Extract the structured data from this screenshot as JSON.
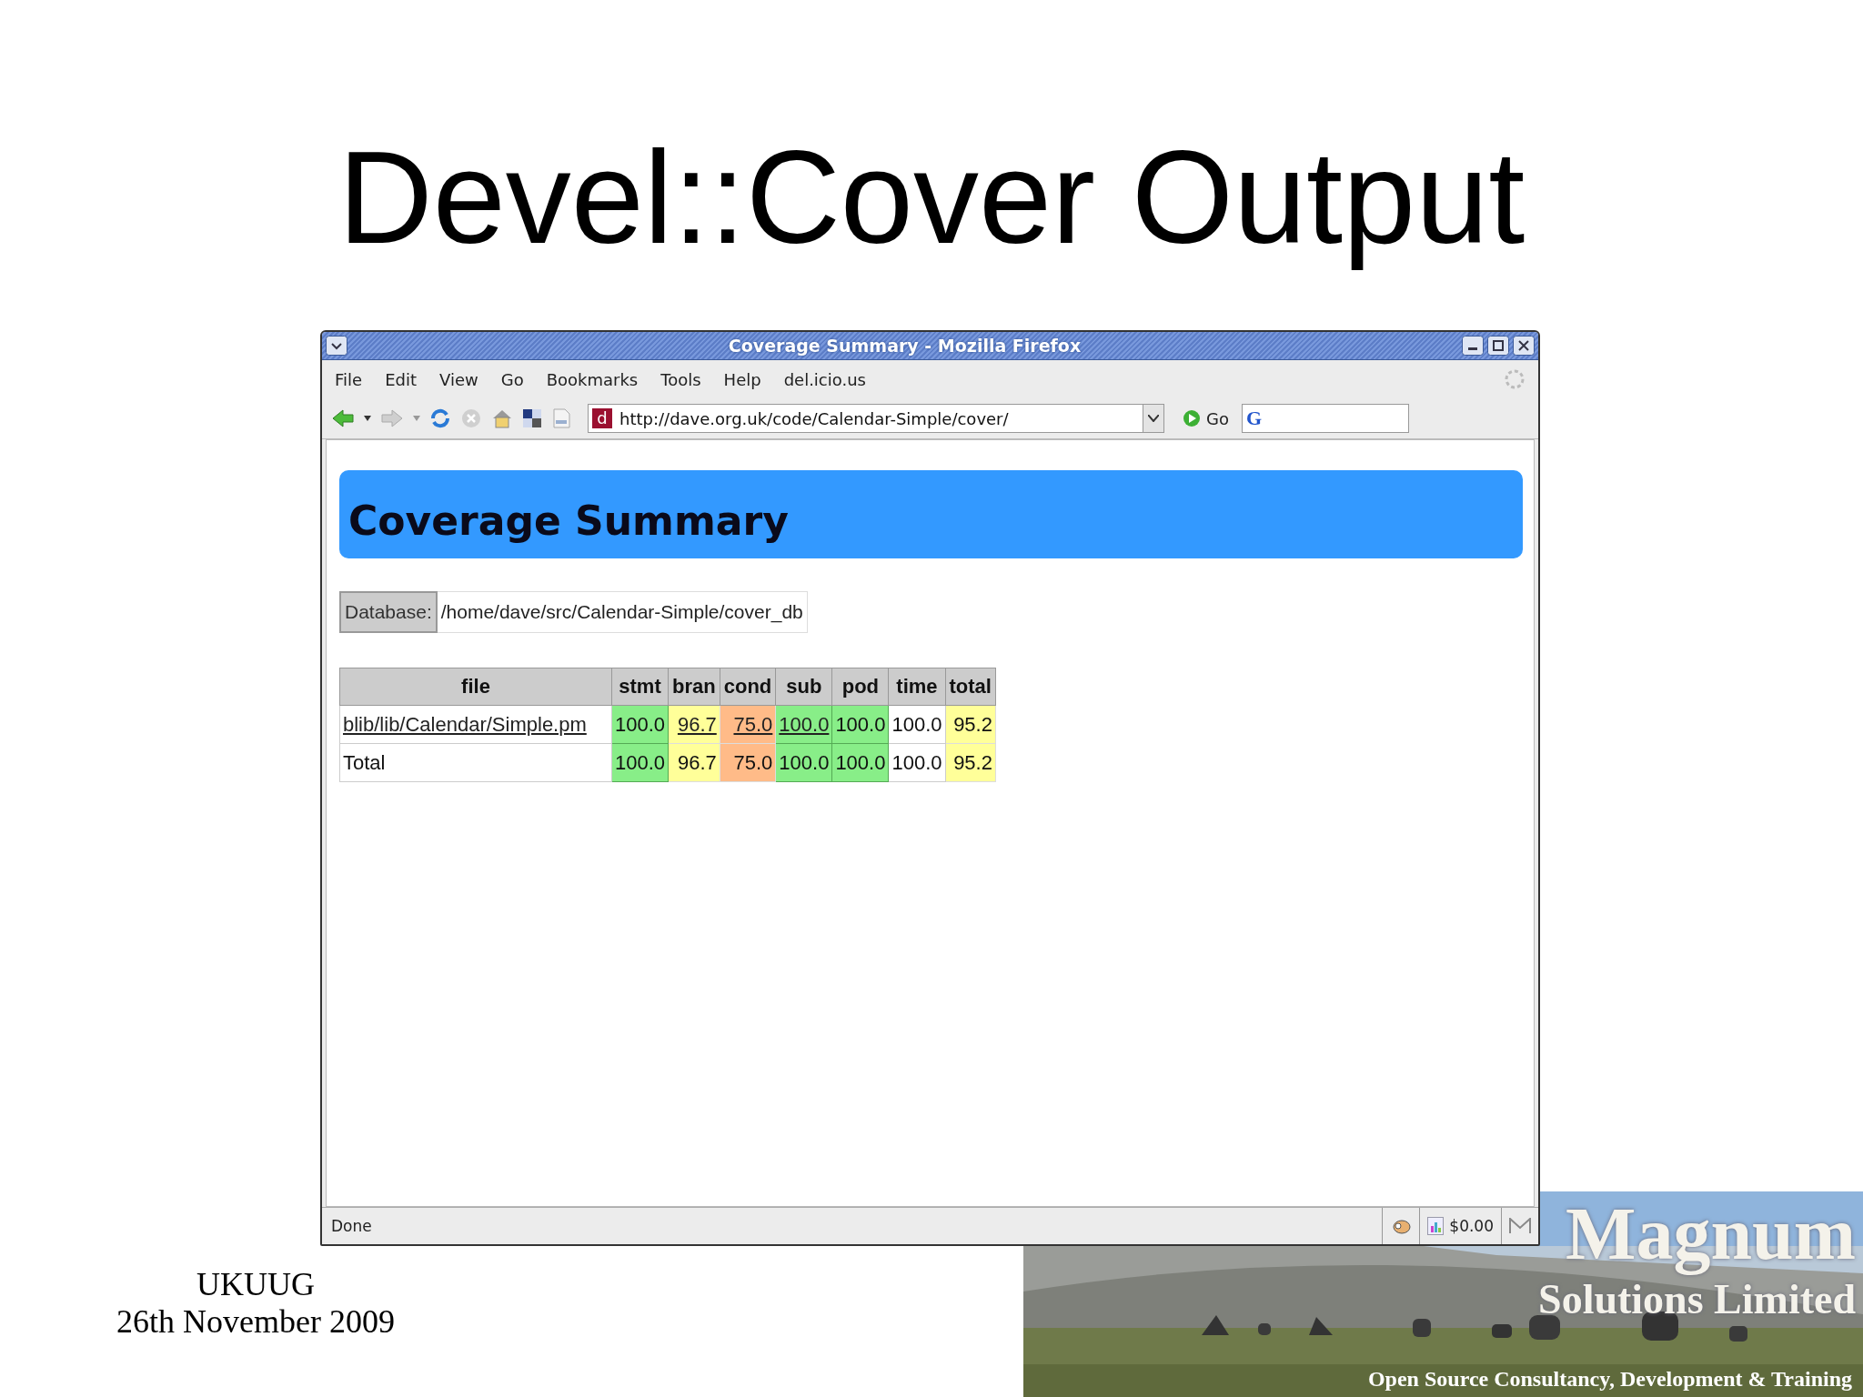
{
  "slide": {
    "title": "Devel::Cover Output",
    "footer": [
      "UKUUG",
      "26th November 2009"
    ]
  },
  "browser": {
    "title": "Coverage Summary - Mozilla Firefox",
    "menu": [
      "File",
      "Edit",
      "View",
      "Go",
      "Bookmarks",
      "Tools",
      "Help",
      "del.icio.us"
    ],
    "favicon": "d",
    "url": "http://dave.org.uk/code/Calendar-Simple/cover/",
    "go": "Go",
    "search_logo": "G",
    "status": "Done",
    "status_amount": "$0.00"
  },
  "page": {
    "heading": "Coverage Summary",
    "database_label": "Database:",
    "database_path": "/home/dave/src/Calendar-Simple/cover_db",
    "table": {
      "columns": [
        "file",
        "stmt",
        "bran",
        "cond",
        "sub",
        "pod",
        "time",
        "total"
      ],
      "rows": [
        {
          "cells": [
            {
              "text": "blib/lib/Calendar/Simple.pm",
              "link": true
            },
            {
              "text": "100.0",
              "link": false,
              "color": "#88ee88"
            },
            {
              "text": "96.7",
              "link": true,
              "color": "#ffff99"
            },
            {
              "text": "75.0",
              "link": true,
              "color": "#ffbb88"
            },
            {
              "text": "100.0",
              "link": true,
              "color": "#88ee88"
            },
            {
              "text": "100.0",
              "link": false,
              "color": "#88ee88"
            },
            {
              "text": "100.0",
              "link": false
            },
            {
              "text": "95.2",
              "link": false,
              "color": "#ffff99"
            }
          ]
        },
        {
          "cells": [
            {
              "text": "Total",
              "link": false
            },
            {
              "text": "100.0",
              "link": false,
              "color": "#88ee88"
            },
            {
              "text": "96.7",
              "link": false,
              "color": "#ffff99"
            },
            {
              "text": "75.0",
              "link": false,
              "color": "#ffbb88"
            },
            {
              "text": "100.0",
              "link": false,
              "color": "#88ee88"
            },
            {
              "text": "100.0",
              "link": false,
              "color": "#88ee88"
            },
            {
              "text": "100.0",
              "link": false
            },
            {
              "text": "95.2",
              "link": false,
              "color": "#ffff99"
            }
          ]
        }
      ]
    }
  },
  "banner": {
    "kind": "picture",
    "logo": [
      "Magnum",
      "Solutions Limited"
    ],
    "tagline": "Open Source Consultancy, Development & Training"
  }
}
